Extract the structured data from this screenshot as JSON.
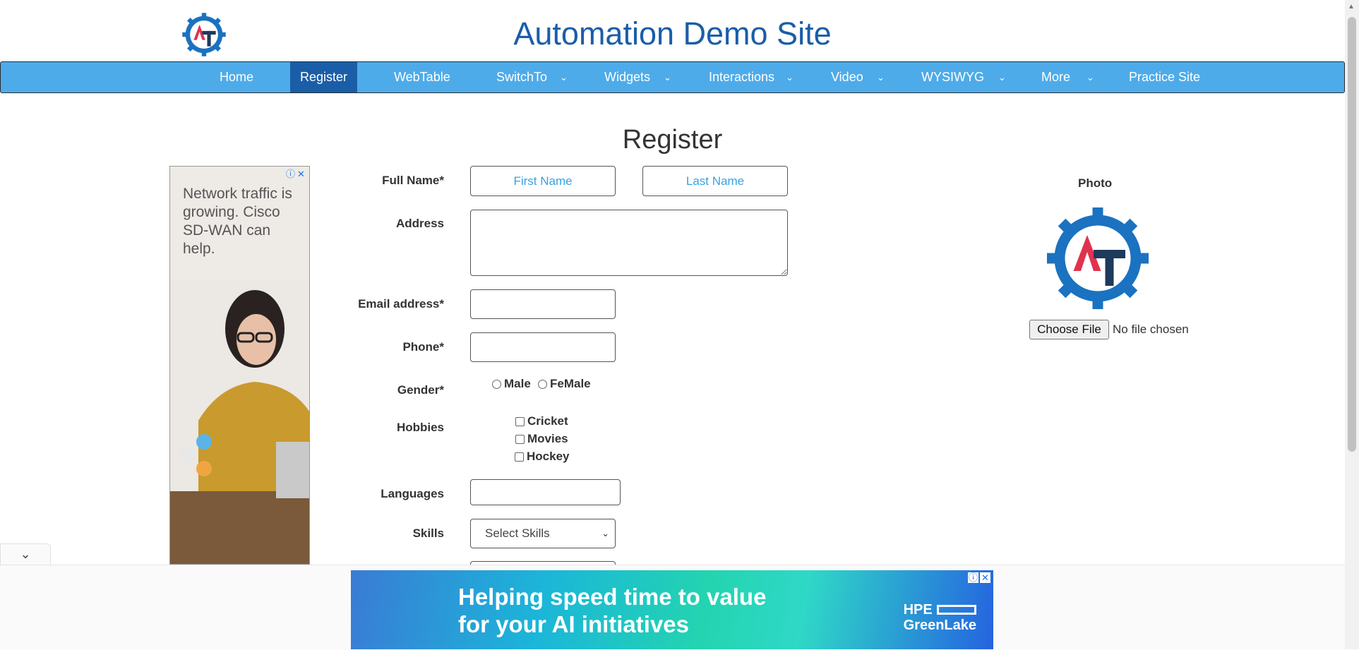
{
  "header": {
    "title": "Automation Demo Site"
  },
  "nav": {
    "items": [
      {
        "label": "Home"
      },
      {
        "label": "Register"
      },
      {
        "label": "WebTable"
      },
      {
        "label": "SwitchTo"
      },
      {
        "label": "Widgets"
      },
      {
        "label": "Interactions"
      },
      {
        "label": "Video"
      },
      {
        "label": "WYSIWYG"
      },
      {
        "label": "More"
      },
      {
        "label": "Practice Site"
      }
    ],
    "active": "Register"
  },
  "page": {
    "heading": "Register"
  },
  "left_ad": {
    "text": "Network traffic is growing. Cisco SD-WAN can help."
  },
  "form": {
    "full_name_label": "Full Name*",
    "first_name_placeholder": "First Name",
    "last_name_placeholder": "Last Name",
    "address_label": "Address",
    "email_label": "Email address*",
    "phone_label": "Phone*",
    "gender_label": "Gender*",
    "gender_options": [
      "Male",
      "FeMale"
    ],
    "hobbies_label": "Hobbies",
    "hobbies": [
      "Cricket",
      "Movies",
      "Hockey"
    ],
    "languages_label": "Languages",
    "skills_label": "Skills",
    "skills_selected": "Select Skills"
  },
  "photo": {
    "label": "Photo",
    "file_button": "Choose File",
    "file_status": "No file chosen"
  },
  "bottom_ad": {
    "line1": "Helping speed time to value",
    "line2": "for your AI initiatives",
    "brand_line1": "HPE",
    "brand_line2": "GreenLake"
  },
  "colors": {
    "nav_bg": "#4eabe9",
    "nav_active": "#1a5ea8",
    "title": "#1a5ea8",
    "placeholder": "#37a2e0"
  }
}
